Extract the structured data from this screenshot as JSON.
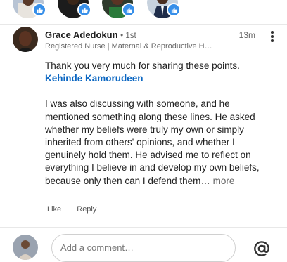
{
  "reactors": [
    {
      "reaction": "like"
    },
    {
      "reaction": "like"
    },
    {
      "reaction": "like"
    },
    {
      "reaction": "like"
    }
  ],
  "comment": {
    "author_name": "Grace Adedokun",
    "degree": "• 1st",
    "timestamp": "13m",
    "headline": "Registered Nurse | Maternal & Reproductive Health",
    "text_intro": "Thank you very much for sharing these points.",
    "mention": "Kehinde Kamorudeen",
    "text_body": "I was also discussing with someone, and he mentioned something along these lines. He asked whether my beliefs were truly my own or simply inherited from others' opinions, and whether I genuinely hold them. He advised me to reflect on everything I believe in and develop my own beliefs, because only then can I defend them",
    "ellipsis": "…",
    "more_label": "more",
    "actions": {
      "like_label": "Like",
      "reply_label": "Reply"
    }
  },
  "composer": {
    "placeholder": "Add a comment…",
    "mention_icon": "at-icon"
  },
  "colors": {
    "link": "#0a66c2",
    "like_badge": "#378fe9",
    "meta_text": "#666666"
  }
}
